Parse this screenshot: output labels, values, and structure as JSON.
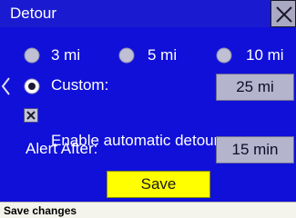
{
  "window": {
    "title": "Detour",
    "close_icon": "close-icon"
  },
  "nav": {
    "back_icon": "chevron-left-icon"
  },
  "distance_options": [
    {
      "label": "3 mi",
      "selected": false
    },
    {
      "label": "5 mi",
      "selected": false
    },
    {
      "label": "10 mi",
      "selected": false
    }
  ],
  "custom": {
    "label": "Custom:",
    "selected": true,
    "value": "25 mi"
  },
  "auto_detour": {
    "label": "Enable automatic detour",
    "checked": true
  },
  "alert": {
    "label": "Alert After:",
    "value": "15 min"
  },
  "save_label": "Save",
  "status": {
    "text": "Save changes"
  },
  "colors": {
    "background": "#1010d8",
    "button": "#b4b4cc",
    "save_button": "#ffff00",
    "status_bar": "#f4f4ec"
  }
}
